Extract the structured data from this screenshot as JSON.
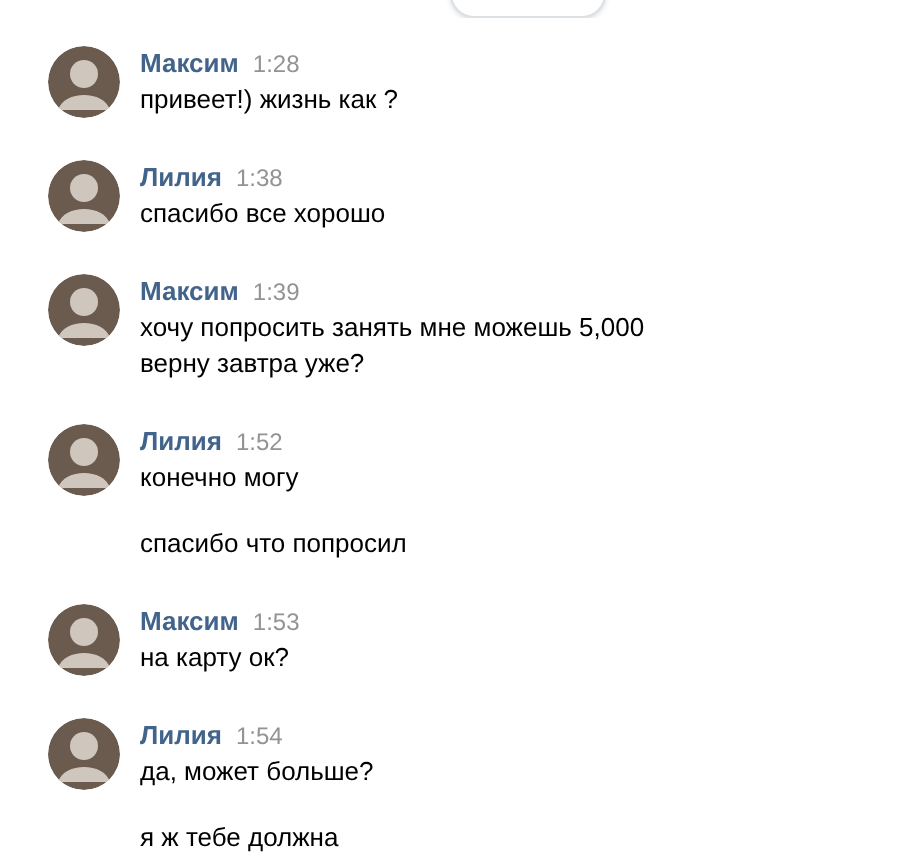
{
  "groups": [
    {
      "author": "Максим",
      "time": "1:28",
      "messages": [
        {
          "lines": [
            "привеет!) жизнь как ?"
          ]
        }
      ]
    },
    {
      "author": "Лилия",
      "time": "1:38",
      "messages": [
        {
          "lines": [
            "спасибо все хорошо"
          ]
        }
      ]
    },
    {
      "author": "Максим",
      "time": "1:39",
      "messages": [
        {
          "lines": [
            "хочу попросить занять мне можешь 5,000",
            "верну завтра уже?"
          ]
        }
      ]
    },
    {
      "author": "Лилия",
      "time": "1:52",
      "messages": [
        {
          "lines": [
            "конечно могу"
          ]
        },
        {
          "lines": [
            "спасибо что попросил"
          ]
        }
      ]
    },
    {
      "author": "Максим",
      "time": "1:53",
      "messages": [
        {
          "lines": [
            "на карту ок?"
          ]
        }
      ]
    },
    {
      "author": "Лилия",
      "time": "1:54",
      "messages": [
        {
          "lines": [
            "да, может больше?"
          ]
        },
        {
          "lines": [
            "я ж тебе должна"
          ]
        }
      ]
    }
  ]
}
